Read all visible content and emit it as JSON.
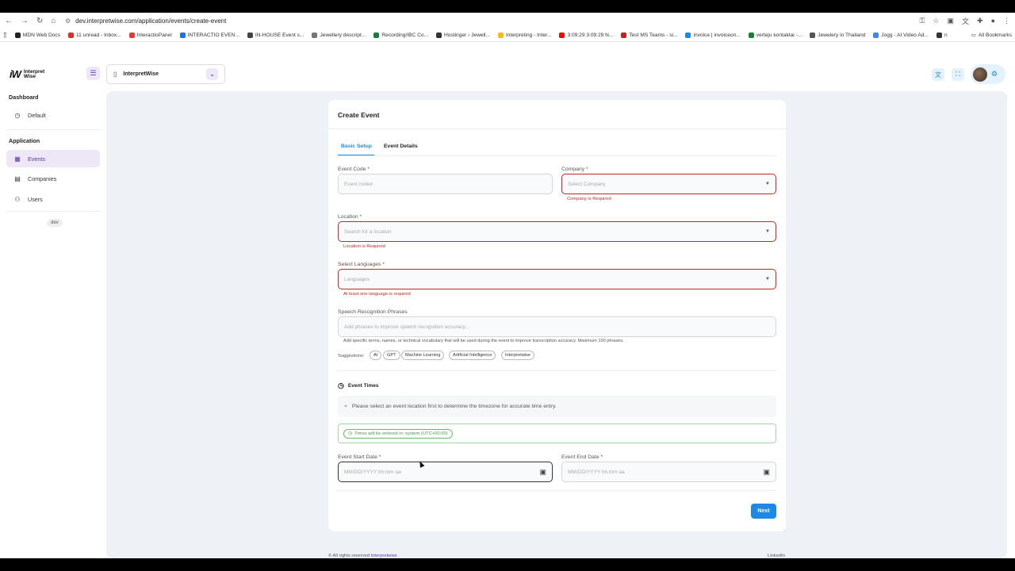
{
  "browser": {
    "url": "dev.interpretwise.com/application/events/create-event",
    "bookmarks": [
      {
        "label": "MDN Web Docs",
        "color": "#222"
      },
      {
        "label": "11 unread - Inbox...",
        "color": "#d93025"
      },
      {
        "label": "InteractioPanel",
        "color": "#e53935"
      },
      {
        "label": "INTERACTIO EVEN...",
        "color": "#1a73e8"
      },
      {
        "label": "IN-HOUSE Event s...",
        "color": "#444"
      },
      {
        "label": "Jewellery descript...",
        "color": "#777"
      },
      {
        "label": "Recording/IBC Co...",
        "color": "#188038"
      },
      {
        "label": "Hostinger ‹ Jewell...",
        "color": "#333"
      },
      {
        "label": "Interpreting - Inter...",
        "color": "#fbbc04"
      },
      {
        "label": "3:09:29 3:09:29 N...",
        "color": "#ff0000"
      },
      {
        "label": "Test MS Teams - si...",
        "color": "#c5221f"
      },
      {
        "label": "invoice | invoiceon...",
        "color": "#1e88e5"
      },
      {
        "label": "verteju kontaktai -...",
        "color": "#188038"
      },
      {
        "label": "Jewelery in Thailand",
        "color": "#555"
      },
      {
        "label": "Jogg - AI Video Ad...",
        "color": "#4285f4"
      },
      {
        "label": "n",
        "color": "#333"
      }
    ],
    "all_bookmarks": "All Bookmarks"
  },
  "app": {
    "logo_line1": "Interpret",
    "logo_line2": "Wise",
    "workspace": "InterpretWise"
  },
  "sidebar": {
    "section_dashboard": "Dashboard",
    "item_default": "Default",
    "section_application": "Application",
    "item_events": "Events",
    "item_companies": "Companies",
    "item_users": "Users",
    "env_chip": "dev"
  },
  "form": {
    "title": "Create Event",
    "tab_basic": "Basic Setup",
    "tab_details": "Event Details",
    "event_code_label": "Event Code *",
    "event_code_placeholder": "Event code#",
    "company_label": "Company *",
    "company_placeholder": "Select Company",
    "company_error": "Company is Required",
    "location_label": "Location *",
    "location_placeholder": "Search for a location",
    "location_error": "Location is Required",
    "languages_label": "Select Languages *",
    "languages_placeholder": "Languages",
    "languages_error": "At least one language is required",
    "speech_label": "Speech Recognition Phrases",
    "speech_placeholder": "Add phrases to improve speech recognition accuracy...",
    "speech_help": "Add specific terms, names, or technical vocabulary that will be used during the event to improve transcription accuracy. Maximum 100 phrases.",
    "suggestions_label": "Suggestions:",
    "suggestions": [
      "AI",
      "GPT",
      "Machine Learning",
      "Artificial Intelligence",
      "Interpretwise"
    ],
    "times_title": "Event Times",
    "times_info": "Please select an event location first to determine the timezone for accurate time entry.",
    "tz_notice": "Times will be entered in: system (UTC+00:00)",
    "start_label": "Event Start Date *",
    "start_placeholder": "MM/DD/YYYY hh:mm aa",
    "end_label": "Event End Date *",
    "end_placeholder": "MM/DD/YYYY hh:mm aa",
    "next": "Next"
  },
  "footer": {
    "copyright": "© All rights reserved",
    "brand": "Interpretwise",
    "link": "LinkedIn"
  }
}
